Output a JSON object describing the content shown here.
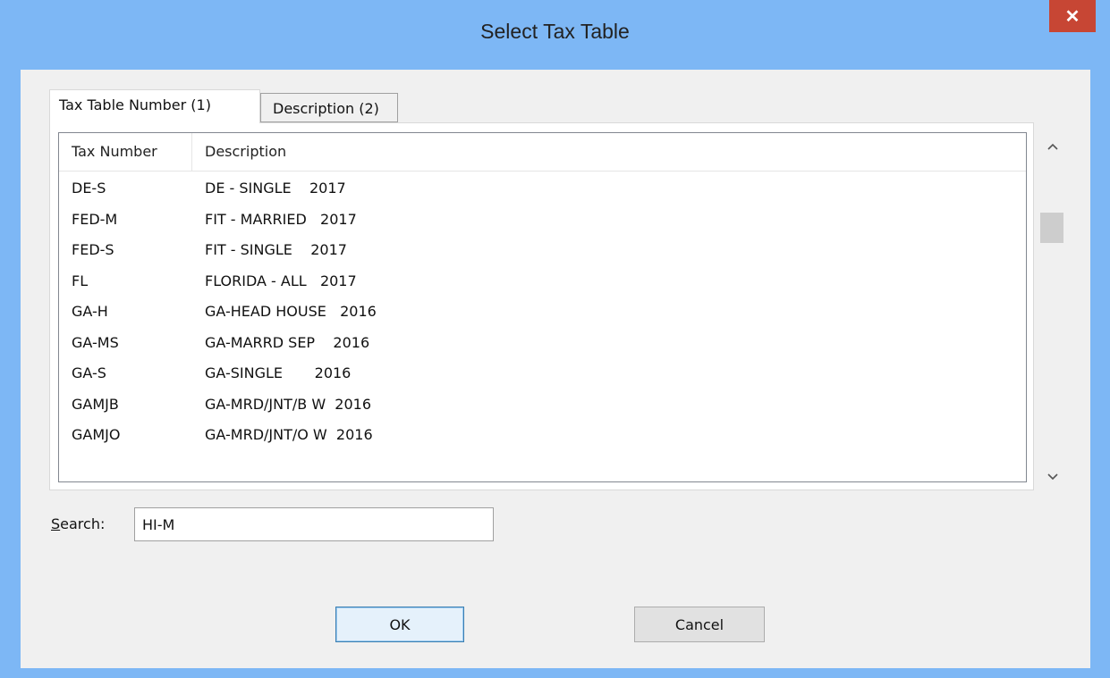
{
  "window": {
    "title": "Select Tax Table",
    "close_glyph": "✕"
  },
  "tabs": [
    {
      "label": "Tax Table Number (1)",
      "active": true
    },
    {
      "label": "Description (2)",
      "active": false
    }
  ],
  "list": {
    "columns": [
      "Tax Number",
      "Description"
    ],
    "rows": [
      {
        "number": "DE-S",
        "description": "DE - SINGLE    2017"
      },
      {
        "number": "FED-M",
        "description": "FIT - MARRIED   2017"
      },
      {
        "number": "FED-S",
        "description": "FIT - SINGLE    2017"
      },
      {
        "number": "FL",
        "description": "FLORIDA - ALL   2017"
      },
      {
        "number": "GA-H",
        "description": "GA-HEAD HOUSE   2016"
      },
      {
        "number": "GA-MS",
        "description": "GA-MARRD SEP    2016"
      },
      {
        "number": "GA-S",
        "description": "GA-SINGLE       2016"
      },
      {
        "number": "GAMJB",
        "description": "GA-MRD/JNT/B W  2016"
      },
      {
        "number": "GAMJO",
        "description": "GA-MRD/JNT/O W  2016"
      }
    ]
  },
  "scrollbar": {
    "up_glyph": "^",
    "down_glyph": "v"
  },
  "search": {
    "label_accel": "S",
    "label_rest": "earch:",
    "value": "HI-M"
  },
  "buttons": {
    "ok": "OK",
    "cancel": "Cancel"
  }
}
